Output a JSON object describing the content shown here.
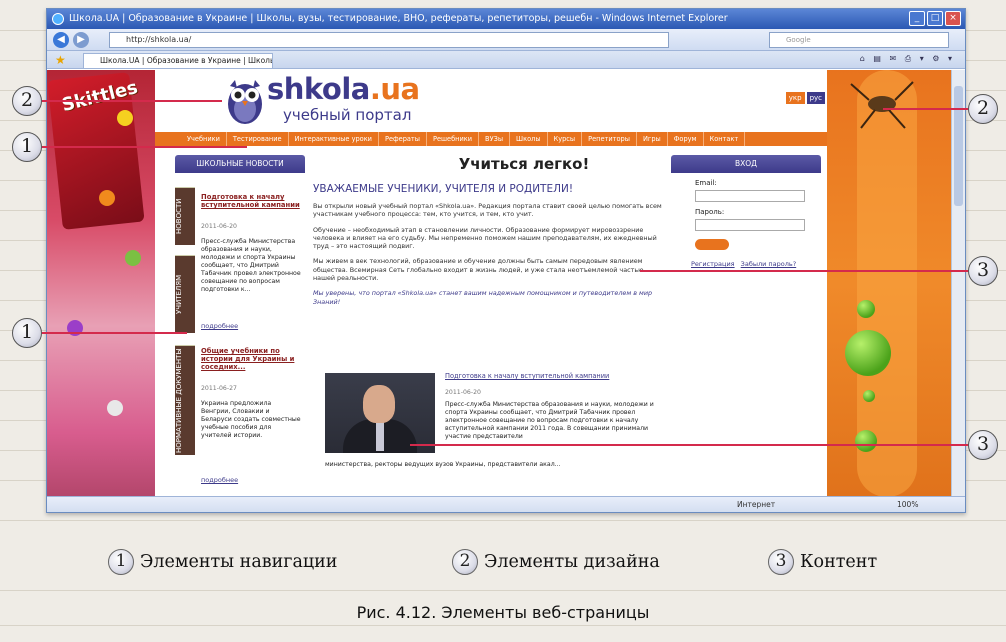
{
  "browser": {
    "title": "Школа.UA | Образование в Украине | Школы, вузы, тестирование, ВНО, рефераты, репетиторы, решебн - Windows Internet Explorer",
    "address": "http://shkola.ua/",
    "search_placeholder": "Google",
    "tab_label": "Школа.UA | Образование в Украине | Школы, вуз...",
    "status_zone": "Интернет",
    "zoom": "100%"
  },
  "ads": {
    "left_brand": "Skittles"
  },
  "site": {
    "logo": "shkola",
    "logo_tld": ".ua",
    "logo_sub": "учебный портал",
    "lang": [
      "укр",
      "рус"
    ],
    "menu": [
      "Учебники",
      "Тестирование",
      "Интерактивные уроки",
      "Рефераты",
      "Решебники",
      "ВУЗы",
      "Школы",
      "Курсы",
      "Репетиторы",
      "Игры",
      "Форум",
      "Контакт"
    ],
    "news_header": "ШКОЛЬНЫЕ НОВОСТИ",
    "side_tabs": [
      "НОВОСТИ",
      "УЧИТЕЛЯМ",
      "НОРМАТИВНЫЕ ДОКУМЕНТЫ"
    ],
    "news": [
      {
        "title": "Подготовка к началу вступительной кампании",
        "date": "2011-06-20",
        "body": "Пресс-служба Министерства образования и науки, молодежи и спорта Украины сообщает, что Дмитрий Табачник провел электронное совещание по вопросам подготовки к...",
        "more": "подробнее"
      },
      {
        "title": "Общие учебники по истории для Украины и соседних...",
        "date": "2011-06-27",
        "body": "Украина предложила Венгрии, Словакии и Беларуси создать совместные учебные пособия для учителей истории.",
        "more": "подробнее"
      }
    ],
    "welcome_title": "Учиться легко!",
    "welcome_sub": "УВАЖАЕМЫЕ УЧЕНИКИ, УЧИТЕЛЯ И РОДИТЕЛИ!",
    "paragraphs": [
      "Вы открыли новый учебный портал «Shkola.ua». Редакция портала ставит своей целью помогать всем участникам учебного процесса: тем, кто учится, и тем, кто учит.",
      "Обучение – необходимый этап в становлении личности. Образование формирует мировоззрение человека и влияет на его судьбу. Мы непременно поможем нашим преподавателям, их ежедневный труд – это настоящий подвиг.",
      "Мы живем в век технологий, образование и обучение должны быть самым передовым явлением общества. Всемирная Сеть глобально входит в жизнь людей, и уже стала неотъемлемой частью нашей реальности."
    ],
    "paragraph_italic": "Мы уверены, что портал «Shkola.ua» станет вашим надежным помощником и путеводителем в мир Знаний!",
    "feature": {
      "title": "Подготовка к началу вступительной кампании",
      "date": "2011-06-20",
      "body": "Пресс-служба Министерства образования и науки, молодежи и спорта Украины сообщает, что Дмитрий Табачник провел электронное совещание по вопросам подготовки к началу вступительной кампании 2011 года. В совещании принимали участие представители",
      "foot": "министерства, ректоры ведущих вузов Украины, представители акал..."
    },
    "login": {
      "header": "ВХОД",
      "email_label": "Email:",
      "password_label": "Пароль:",
      "button": "ВХОД",
      "register": "Регистрация",
      "forgot": "Забыли пароль?"
    }
  },
  "callouts": [
    "1",
    "2",
    "3"
  ],
  "legend": [
    {
      "num": "1",
      "text": "Элементы навигации"
    },
    {
      "num": "2",
      "text": "Элементы дизайна"
    },
    {
      "num": "3",
      "text": "Контент"
    }
  ],
  "caption": "Рис. 4.12. Элементы веб-страницы",
  "colors": {
    "accent_orange": "#e8731e",
    "brand_purple": "#3d3a8a",
    "callout_line": "#d42a4c"
  }
}
